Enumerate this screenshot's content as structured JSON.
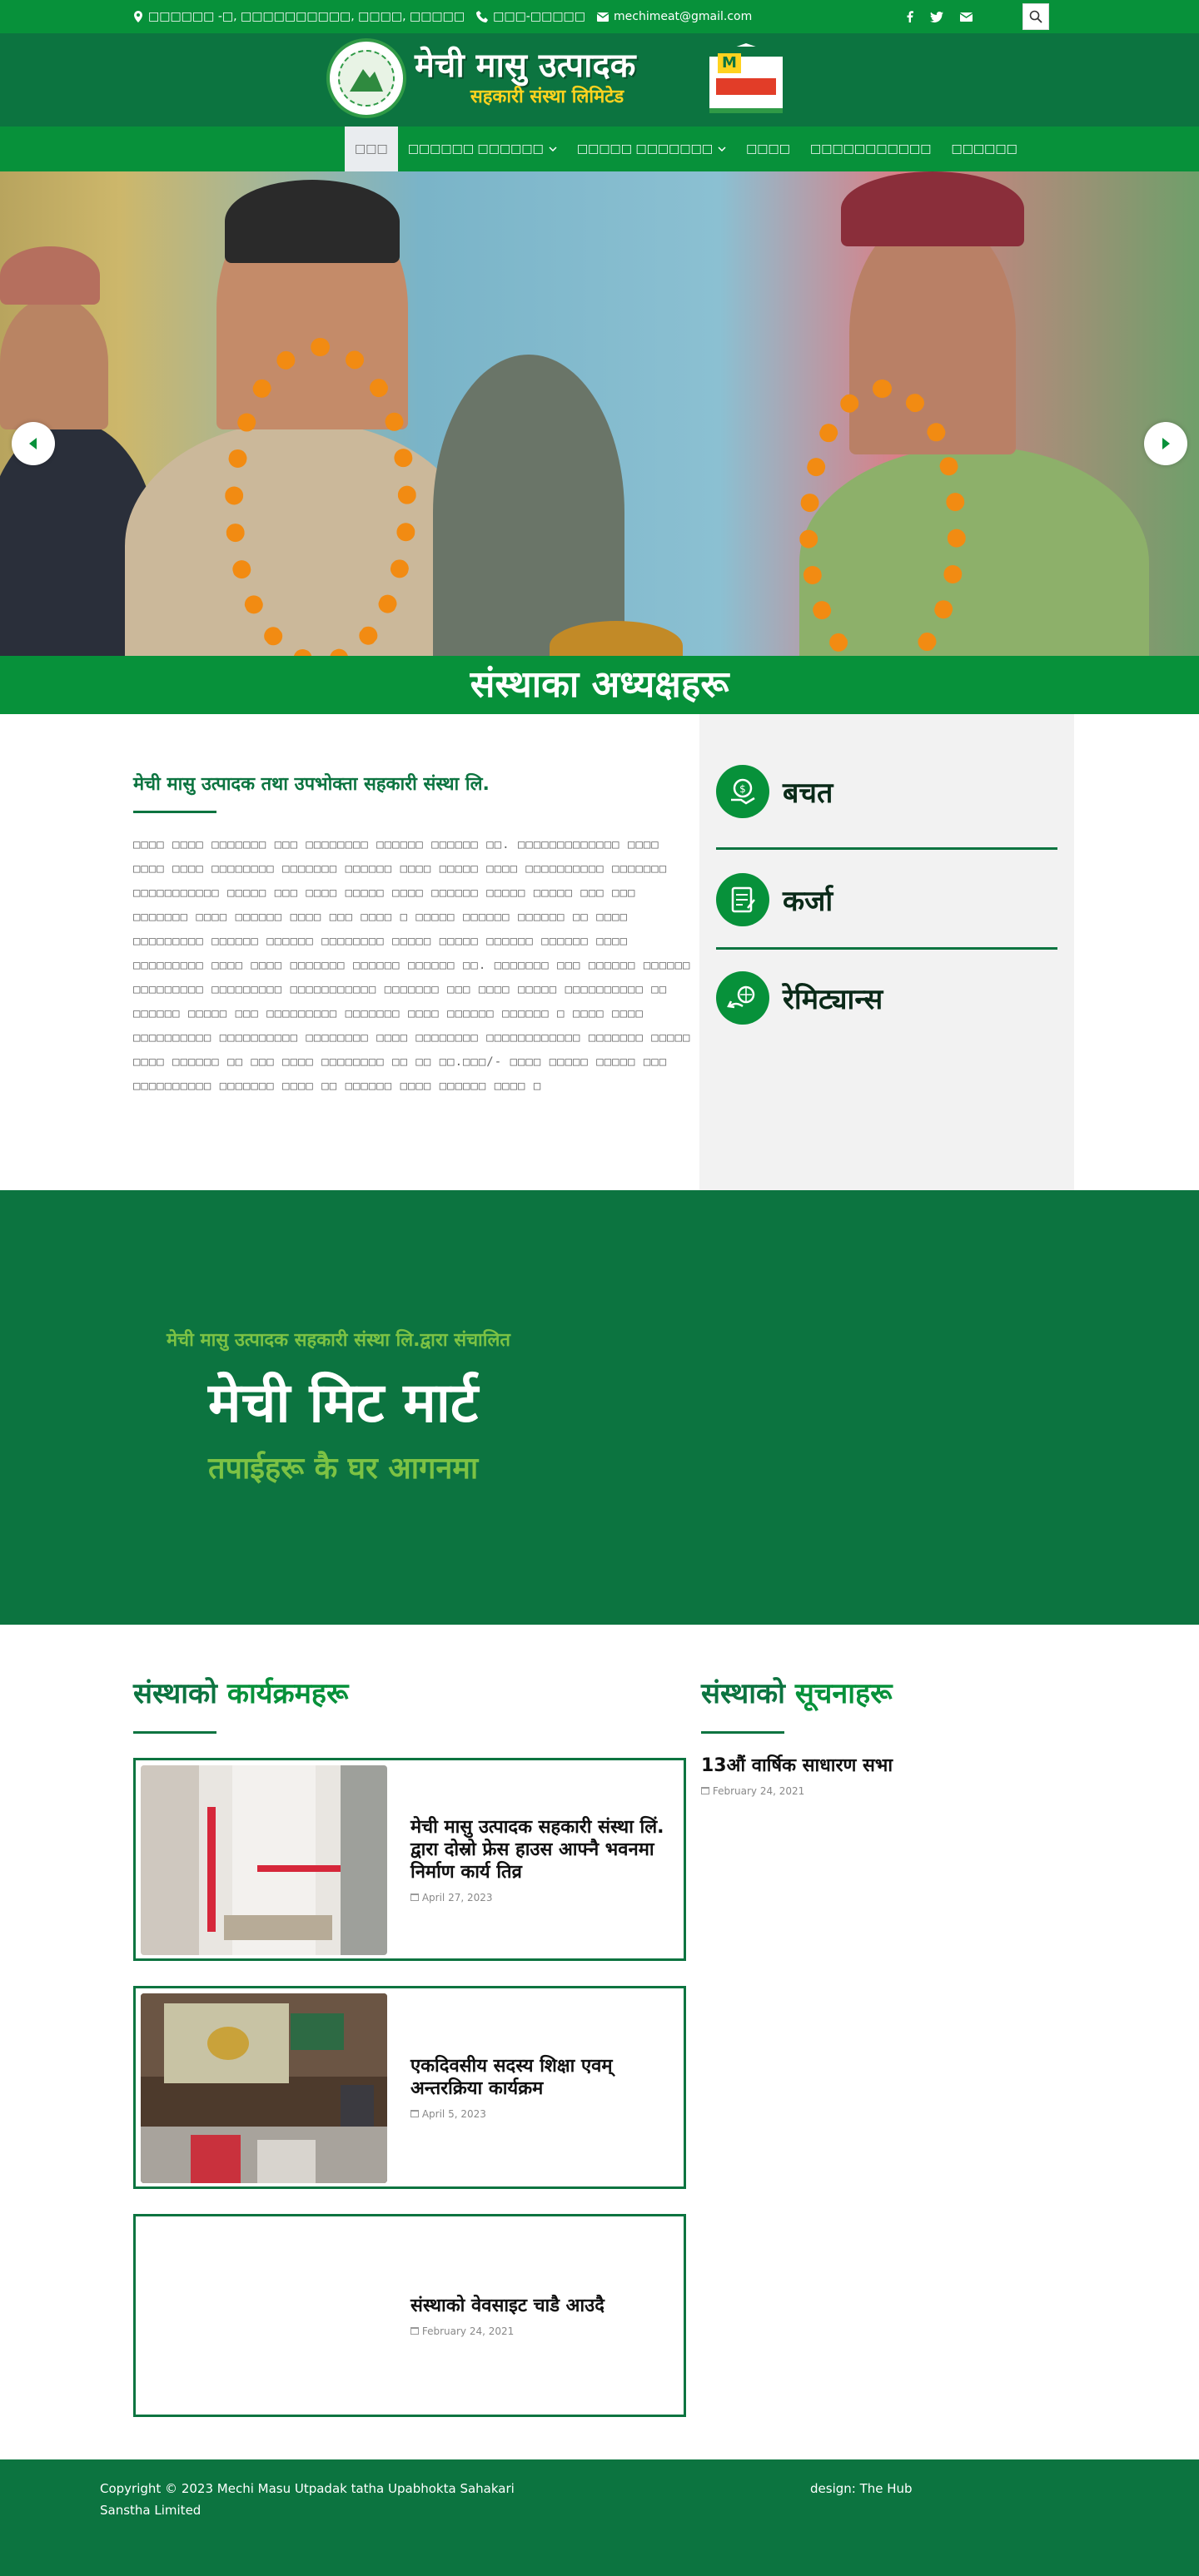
{
  "topbar": {
    "address": "□□□□□□ -□, □□□□□□□□□□, □□□□, □□□□□",
    "phone": "□□□-□□□□□",
    "email": "mechimeat@gmail.com",
    "icons": [
      "location-icon",
      "phone-icon",
      "mail-icon",
      "facebook-icon",
      "twitter-icon",
      "envelope-icon",
      "search-icon"
    ]
  },
  "header": {
    "brand_main": "मेची मासु उत्पादक",
    "brand_sub": "सहकारी संस्था लिमिटेड",
    "mart_letter": "M"
  },
  "nav": {
    "items": [
      {
        "label": "□□□",
        "active": true,
        "dropdown": false
      },
      {
        "label": "□□□□□□ □□□□□□",
        "active": false,
        "dropdown": true
      },
      {
        "label": "□□□□□ □□□□□□□",
        "active": false,
        "dropdown": true
      },
      {
        "label": "□□□□",
        "active": false,
        "dropdown": false
      },
      {
        "label": "□□□□□□□□□□□",
        "active": false,
        "dropdown": false
      },
      {
        "label": "□□□□□□",
        "active": false,
        "dropdown": false
      }
    ]
  },
  "hero": {
    "banner_title": "संस्थाका अध्यक्षहरू"
  },
  "intro": {
    "heading": "मेची मासु उत्पादक तथा उपभोक्ता सहकारी संस्था लि.",
    "body": "□□□□ □□□□ □□□□□□□ □□□ □□□□□□□□ □□□□□□ □□□□□□ □□. □□□□□□□□□□□□□ □□□□ □□□□ □□□□ □□□□□□□□ □□□□□□□ □□□□□□ □□□□ □□□□□ □□□□ □□□□□□□□□□ □□□□□□□ □□□□□□□□□□□ □□□□□ □□□ □□□□ □□□□□ □□□□ □□□□□□ □□□□□ □□□□□ □□□ □□□ □□□□□□□ □□□□ □□□□□□ □□□□ □□□ □□□□ □ □□□□□ □□□□□□ □□□□□□ □□ □□□□ □□□□□□□□□ □□□□□□ □□□□□□ □□□□□□□□ □□□□□ □□□□□ □□□□□□ □□□□□□ □□□□ □□□□□□□□□ □□□□ □□□□ □□□□□□□ □□□□□□ □□□□□□ □□. □□□□□□□ □□□ □□□□□□ □□□□□□ □□□□□□□□□ □□□□□□□□□ □□□□□□□□□□□ □□□□□□□ □□□ □□□□ □□□□□ □□□□□□□□□□ □□ □□□□□□ □□□□□ □□□ □□□□□□□□□ □□□□□□□ □□□□ □□□□□□ □□□□□□ □ □□□□ □□□□ □□□□□□□□□□ □□□□□□□□□□ □□□□□□□□ □□□□ □□□□□□□□ □□□□□□□□□□□□ □□□□□□□ □□□□□ □□□□ □□□□□□ □□ □□□ □□□□ □□□□□□□□ □□ □□ □□.□□□/- □□□□ □□□□□ □□□□□ □□□ □□□□□□□□□□ □□□□□□□ □□□□ □□ □□□□□□ □□□□ □□□□□□ □□□□ □",
    "services": [
      {
        "label": "बचत",
        "icon": "savings-icon"
      },
      {
        "label": "कर्जा",
        "icon": "loan-icon"
      },
      {
        "label": "रेमिट्यान्स",
        "icon": "remittance-icon"
      }
    ]
  },
  "mart_banner": {
    "small": "मेची मासु उत्पादक सहकारी संस्था लि.द्वारा संचालित",
    "big": "मेची मिट मार्ट",
    "tagline": "तपाईहरू कै घर आगनमा"
  },
  "programs": {
    "title_plain": "संस्थाको",
    "title_accent": "कार्यक्रमहरू",
    "cards": [
      {
        "title": "मेची मासु उत्पादक सहकारी संस्था लिं. द्वारा दोस्रो फ्रेस हाउस आफ्नै भवनमा निर्माण कार्य तिव्र",
        "date": "April 27, 2023"
      },
      {
        "title": "एकदिवसीय सदस्य शिक्षा एवम् अन्तरक्रिया कार्यक्रम",
        "date": "April 5, 2023"
      },
      {
        "title": "संस्थाको वेवसाइट चाडै आउदै",
        "date": "February 24, 2021"
      }
    ]
  },
  "notices": {
    "title_plain": "संस्थाको",
    "title_accent": "सूचनाहरू",
    "items": [
      {
        "title": "13औं वार्षिक साधारण सभा",
        "date": "February 24, 2021"
      }
    ]
  },
  "footer": {
    "copyright": "Copyright © 2023 Mechi Masu Utpadak tatha Upabhokta Sahakari Sanstha Limited",
    "design": "design: The Hub"
  },
  "colors": {
    "primary_green": "#07913a",
    "dark_green": "#0c7440",
    "accent_yellow": "#ffd21f",
    "light_green": "#7cc244"
  }
}
